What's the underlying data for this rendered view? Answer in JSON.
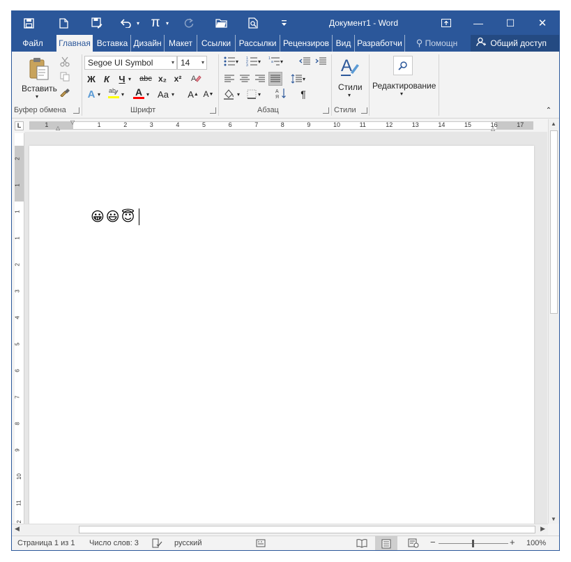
{
  "qat": {
    "save_icon": "save-icon",
    "new_icon": "new-document-icon",
    "save_as_icon": "save-as-icon",
    "undo_icon": "undo-icon",
    "equation_label": "π",
    "redo_icon": "redo-icon",
    "open_icon": "open-folder-icon",
    "print_preview_icon": "print-preview-icon",
    "customize_icon": "customize-icon"
  },
  "window": {
    "title": "Документ1 - Word",
    "ribbon_display_icon": "ribbon-display-options-icon",
    "minimize": "—",
    "maximize": "☐",
    "close": "✕"
  },
  "tabs": [
    {
      "label": "Файл"
    },
    {
      "label": "Главная"
    },
    {
      "label": "Вставка"
    },
    {
      "label": "Дизайн"
    },
    {
      "label": "Макет"
    },
    {
      "label": "Ссылки"
    },
    {
      "label": "Рассылки"
    },
    {
      "label": "Рецензиров"
    },
    {
      "label": "Вид"
    },
    {
      "label": "Разработчи"
    }
  ],
  "tell_me": "Помощн",
  "share": "Общий доступ",
  "ribbon": {
    "clipboard": {
      "paste_label": "Вставить",
      "group_label": "Буфер обмена"
    },
    "font": {
      "font_name": "Segoe UI Symbol",
      "font_size": "14",
      "bold": "Ж",
      "italic": "К",
      "underline": "Ч",
      "strike": "abc",
      "subscript": "x₂",
      "superscript": "x²",
      "text_effects": "A",
      "font_color": "A",
      "change_case": "Aa",
      "grow": "A",
      "shrink": "A",
      "group_label": "Шрифт"
    },
    "paragraph": {
      "show_marks": "¶",
      "group_label": "Абзац"
    },
    "styles": {
      "label": "Стили",
      "group_label": "Стили"
    },
    "editing": {
      "label": "Редактирование"
    }
  },
  "ruler": {
    "marks": [
      "1",
      "1",
      "2",
      "3",
      "4",
      "5",
      "6",
      "7",
      "8",
      "9",
      "10",
      "11",
      "12",
      "13",
      "14",
      "15",
      "16",
      "17"
    ],
    "vmarks": [
      "2",
      "1",
      "1",
      "1",
      "2",
      "3",
      "4",
      "5",
      "6",
      "7",
      "8",
      "9",
      "10",
      "11",
      "12"
    ]
  },
  "document": {
    "content": "😀😃😇"
  },
  "status": {
    "page": "Страница 1 из 1",
    "words": "Число слов: 3",
    "language": "русский",
    "zoom": "100%",
    "zoom_minus": "−",
    "zoom_plus": "+"
  },
  "colors": {
    "accent": "#2b579a",
    "highlight": "#ffff00",
    "font_color": "#ff0000"
  }
}
